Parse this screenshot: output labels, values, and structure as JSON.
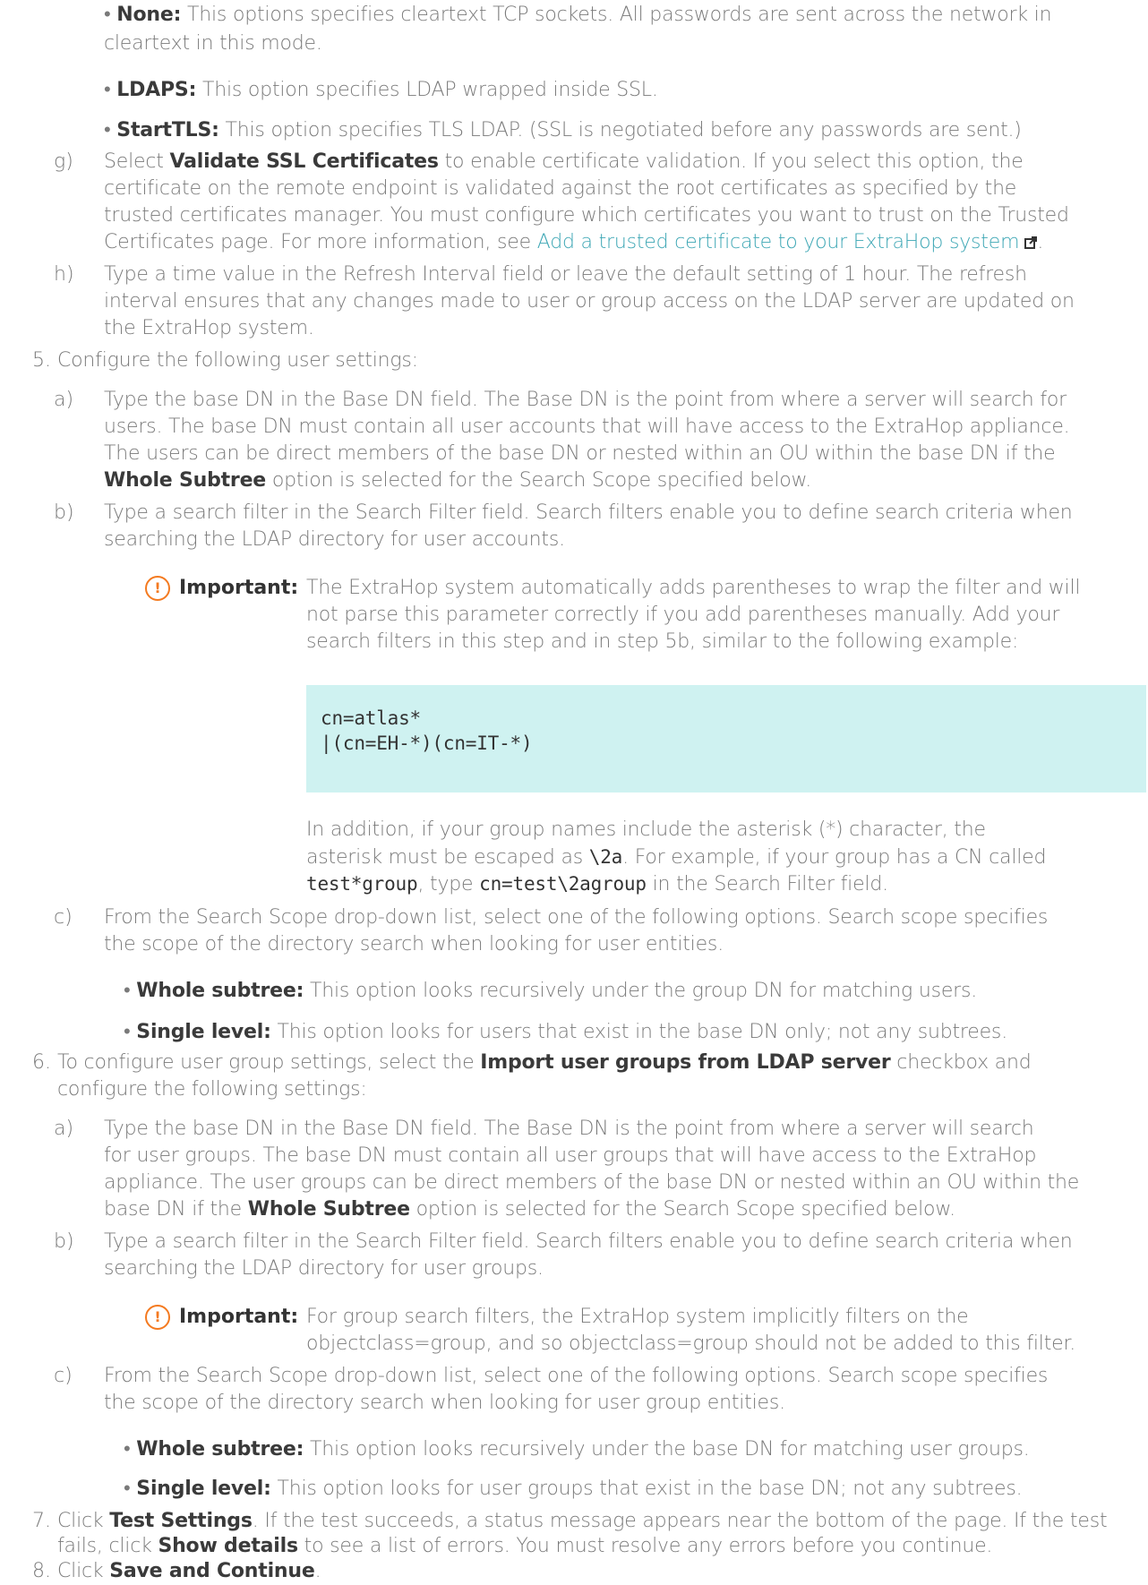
{
  "accent_color": "#3ea7b5",
  "important_icon_color": "#f47a20",
  "code_background": "#cff2f1",
  "important_label": "Important:",
  "step_g": {
    "marker": "g)",
    "pre": "Select ",
    "bold": "Validate SSL Certificates",
    "post": " to enable certificate validation. If you select this option, the",
    "line2": "certificate on the remote endpoint is validated against the root certificates as specified by the",
    "line3": "trusted certificates manager. You must configure which certificates you want to trust on the Trusted",
    "line4_pre": "Certificates page. For more information, see ",
    "link": "Add a trusted certificate to your ExtraHop system"
  },
  "bullets_ssl": [
    {
      "bold": "None:",
      "text": " This options specifies cleartext TCP sockets. All passwords are sent across the network in",
      "cont": "cleartext in this mode."
    },
    {
      "bold": "LDAPS:",
      "text": " This option specifies LDAP wrapped inside SSL."
    },
    {
      "bold": "StartTLS:",
      "text": " This option specifies TLS LDAP. (SSL is negotiated before any passwords are sent.)"
    }
  ],
  "step_h": {
    "marker": "h)",
    "lines": [
      "Type a time value in the Refresh Interval field or leave the default setting of 1 hour. The refresh",
      "interval ensures that any changes made to user or group access on the LDAP server are updated on",
      "the ExtraHop system."
    ]
  },
  "step5": {
    "number": "5.",
    "text": "Configure the following user settings:",
    "a": {
      "marker": "a)",
      "lines": [
        "Type the base DN in the Base DN field. The Base DN is the point from where a server will search for",
        "users. The base DN must contain all user accounts that will have access to the ExtraHop appliance.",
        "The users can be direct members of the base DN or nested within an OU within the base DN if the"
      ],
      "last_bold": "Whole Subtree",
      "last_post": " option is selected for the Search Scope specified below."
    },
    "b": {
      "marker": "b)",
      "lines": [
        "Type a search filter in the Search Filter field. Search filters enable you to define search criteria when",
        "searching the LDAP directory for user accounts."
      ],
      "important_lines": [
        "The ExtraHop system automatically adds parentheses to wrap the filter and will",
        "not parse this parameter correctly if you add parentheses manually. Add your",
        "search filters in this step and in step 5b, similar to the following example:"
      ],
      "code_lines": [
        "cn=atlas*",
        "|(cn=EH-*)(cn=IT-*)"
      ],
      "after1": "In addition, if your group names include the asterisk (*) character, the",
      "after2_pre": "asterisk must be escaped as ",
      "after2_code": "\\2a",
      "after2_post": ". For example, if your group has a CN called",
      "after3_code1": "test*group",
      "after3_mid": ", type ",
      "after3_code2": "cn=test\\2agroup",
      "after3_post": " in the Search Filter field."
    },
    "c": {
      "marker": "c)",
      "lines": [
        "From the Search Scope drop-down list, select one of the following options. Search scope specifies",
        "the scope of the directory search when looking for user entities."
      ],
      "bullets": [
        {
          "bold": "Whole subtree:",
          "text": " This option looks recursively under the group DN for matching users."
        },
        {
          "bold": "Single level:",
          "text": " This option looks for users that exist in the base DN only; not any subtrees."
        }
      ]
    }
  },
  "step6": {
    "number": "6.",
    "pre": "To configure user group settings, select the ",
    "bold": "Import user groups from LDAP server",
    "post": " checkbox and",
    "line2": "configure the following settings:",
    "a": {
      "marker": "a)",
      "lines": [
        "Type the base DN in the Base DN field. The Base DN is the point from where a server will search",
        "for user groups. The base DN must contain all user groups that will have access to the ExtraHop",
        "appliance. The user groups can be direct members of the base DN or nested within an OU within the"
      ],
      "last_pre": "base DN if the ",
      "last_bold": "Whole Subtree",
      "last_post": " option is selected for the Search Scope specified below."
    },
    "b": {
      "marker": "b)",
      "lines": [
        "Type a search filter in the Search Filter field. Search filters enable you to define search criteria when",
        "searching the LDAP directory for user groups."
      ],
      "important_lines": [
        "For group search filters, the ExtraHop system implicitly filters on the",
        "objectclass=group, and so objectclass=group should not be added to this filter."
      ]
    },
    "c": {
      "marker": "c)",
      "lines": [
        "From the Search Scope drop-down list, select one of the following options. Search scope specifies",
        "the scope of the directory search when looking for user group entities."
      ],
      "bullets": [
        {
          "bold": "Whole subtree:",
          "text": " This option looks recursively under the base DN for matching user groups."
        },
        {
          "bold": "Single level:",
          "text": " This option looks for user groups that exist in the base DN; not any subtrees."
        }
      ]
    }
  },
  "step7": {
    "number": "7.",
    "pre": "Click ",
    "bold": "Test Settings",
    "post": ". If the test succeeds, a status message appears near the bottom of the page. If the test",
    "line2_pre": "fails, click ",
    "line2_bold": "Show details",
    "line2_post": " to see a list of errors. You must resolve any errors before you continue."
  },
  "step8": {
    "number": "8.",
    "pre": "Click ",
    "bold": "Save and Continue",
    "post": "."
  }
}
